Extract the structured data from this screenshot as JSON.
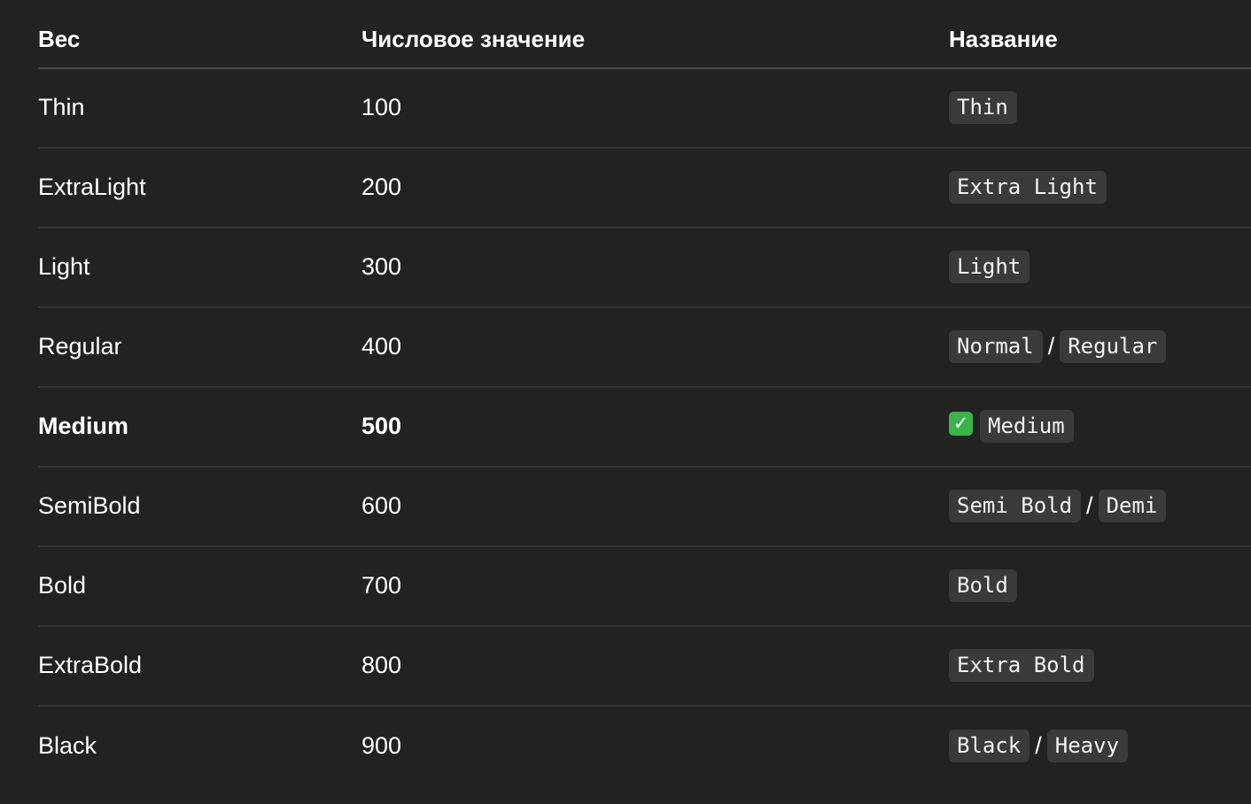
{
  "header": {
    "col_weight": "Вес",
    "col_value": "Числовое значение",
    "col_name": "Название"
  },
  "rows": [
    {
      "weight": "Thin",
      "value": "100",
      "names": [
        "Thin"
      ],
      "sep": ""
    },
    {
      "weight": "ExtraLight",
      "value": "200",
      "names": [
        "Extra Light"
      ],
      "sep": ""
    },
    {
      "weight": "Light",
      "value": "300",
      "names": [
        "Light"
      ],
      "sep": ""
    },
    {
      "weight": "Regular",
      "value": "400",
      "names": [
        "Normal",
        "Regular"
      ],
      "sep": "/"
    },
    {
      "weight": "Medium",
      "value": "500",
      "names": [
        "Medium"
      ],
      "sep": "",
      "highlighted": true,
      "check_icon": "white-check-mark-icon",
      "check_glyph": "✓"
    },
    {
      "weight": "SemiBold",
      "value": "600",
      "names": [
        "Semi Bold",
        "Demi"
      ],
      "sep": "/"
    },
    {
      "weight": "Bold",
      "value": "700",
      "names": [
        "Bold"
      ],
      "sep": ""
    },
    {
      "weight": "ExtraBold",
      "value": "800",
      "names": [
        "Extra Bold"
      ],
      "sep": ""
    },
    {
      "weight": "Black",
      "value": "900",
      "names": [
        "Black",
        "Heavy"
      ],
      "sep": "/"
    }
  ],
  "colors": {
    "background": "#222222",
    "code_background": "#3a3a3a",
    "row_divider": "#343434",
    "header_divider": "#4a4a4a",
    "check_green": "#3ab54a"
  }
}
